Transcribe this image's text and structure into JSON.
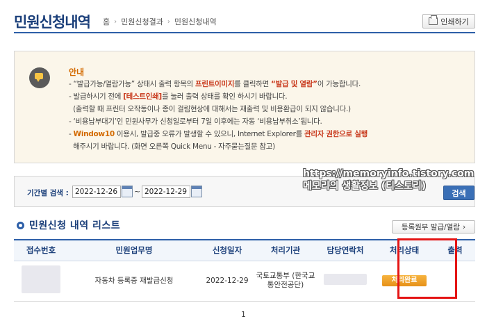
{
  "header": {
    "title": "민원신청내역",
    "breadcrumb": {
      "home_label": "홈",
      "items": [
        "민원신청결과",
        "민원신청내역"
      ]
    },
    "print_label": "인쇄하기"
  },
  "notice": {
    "heading": "안내",
    "lines": [
      {
        "parts": [
          {
            "t": "- “발급가능/열람가능” 상태시 출력 항목의 "
          },
          {
            "t": "프린트이미지",
            "c": "red"
          },
          {
            "t": "를 클릭하면 "
          },
          {
            "t": "“발급 및 열람”",
            "c": "red"
          },
          {
            "t": "이 가능합니다."
          }
        ]
      },
      {
        "parts": [
          {
            "t": "- 발급하시기 전에 "
          },
          {
            "t": "[테스트인쇄]",
            "c": "red"
          },
          {
            "t": "를 눌러 출력 상태를 확인 하시기 바랍니다."
          }
        ]
      },
      {
        "parts": [
          {
            "t": "  (출력할 때 프린터 오작동이나 종이 걸림현상에 대해서는 재출력 및 비용환급이 되지 않습니다.)"
          }
        ]
      },
      {
        "parts": [
          {
            "t": "- ‘비용납부대기’인 민원사무가 신청일로부터 7일 이후에는 자동 ‘비용납부취소’됩니다."
          }
        ]
      },
      {
        "parts": [
          {
            "t": "- "
          },
          {
            "t": "Window10",
            "c": "org"
          },
          {
            "t": " 이용시, 발급중 오류가 발생할 수 있으니, Internet Explorer를 "
          },
          {
            "t": "관리자 권한으로 실행",
            "c": "red"
          }
        ]
      },
      {
        "parts": [
          {
            "t": "  해주시기 바랍니다. (화면 오른쪽 Quick Menu - 자주묻는질문 참고)"
          }
        ]
      }
    ]
  },
  "search": {
    "label": "기간별 검색 :",
    "from": "2022-12-26",
    "tilde": "~",
    "to": "2022-12-29",
    "button": "검색"
  },
  "watermark": {
    "line1": "https://memoryinfo.tistory.com",
    "line2": "메모리의 생활정보 (티스토리)"
  },
  "list": {
    "title": "민원신청 내역 리스트",
    "reg_button": "등록원부 발급/열람",
    "columns": [
      "접수번호",
      "민원업무명",
      "신청일자",
      "처리기관",
      "담당연락처",
      "처리상태",
      "출력"
    ],
    "rows": [
      {
        "receipt_no": "",
        "service": "자동차 등록증 재발급신청",
        "date": "2022-12-29",
        "agency": "국토교통부 (한국교통안전공단)",
        "contact": "",
        "status": "처리완료",
        "output": ""
      }
    ]
  },
  "pager": {
    "current": "1"
  },
  "colors": {
    "accent": "#1b3f7a",
    "highlight_red": "#c8381b",
    "badge": "#e69118",
    "annotation_box": "#e41414"
  }
}
